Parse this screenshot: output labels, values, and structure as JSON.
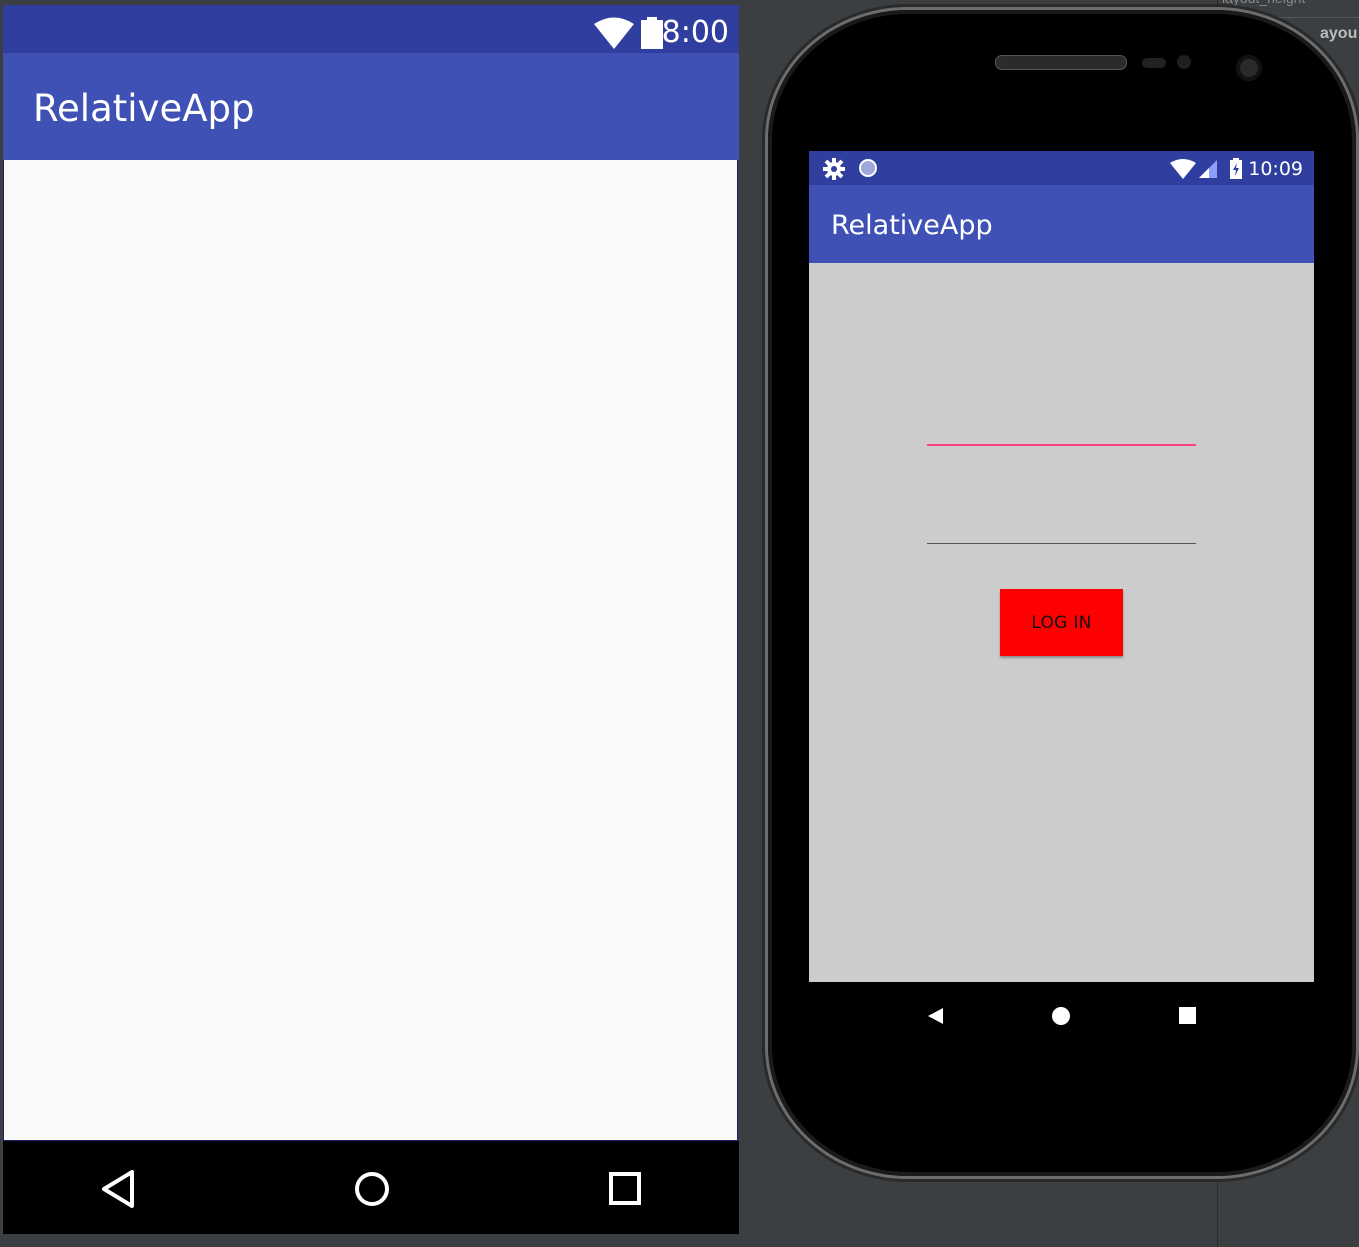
{
  "preview": {
    "status_time": "8:00",
    "app_title": "RelativeApp",
    "nav": [
      "back-icon",
      "home-icon",
      "recents-icon"
    ]
  },
  "sidebar": {
    "top_text": "layout_height",
    "label": "ayou"
  },
  "emulator": {
    "status_time": "10:09",
    "status_icons_left": [
      "gear-icon",
      "circle-icon"
    ],
    "status_icons_right": [
      "wifi-icon",
      "signal-icon",
      "battery-charging-icon"
    ],
    "app_title": "RelativeApp",
    "form": {
      "username_value": "",
      "password_value": "",
      "login_label": "LOG IN"
    },
    "colors": {
      "status_bar": "#303f9f",
      "app_bar": "#3f51b5",
      "content_bg": "#cccccc",
      "accent": "#ff4081",
      "login_button": "#ff0000"
    }
  }
}
